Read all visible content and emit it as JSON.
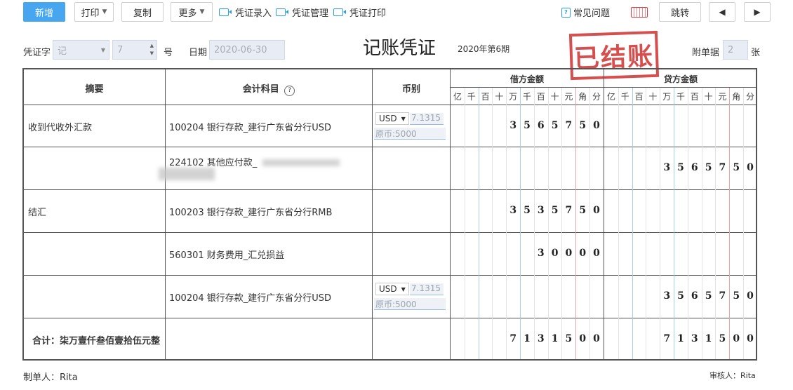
{
  "toolbar": {
    "new_label": "新增",
    "print_label": "打印",
    "copy_label": "复制",
    "more_label": "更多",
    "entry_link": "凭证录入",
    "manage_link": "凭证管理",
    "print_link": "凭证打印",
    "faq_label": "常见问题",
    "jump_label": "跳转"
  },
  "header": {
    "voucher_word_label": "凭证字",
    "voucher_word_value": "记",
    "voucher_number": "7",
    "number_suffix": "号",
    "date_label": "日期",
    "date_value": "2020-06-30",
    "title": "记账凭证",
    "period": "2020年第6期",
    "stamp_text": "已结账",
    "attachments_label": "附单据",
    "attachments_value": "2",
    "attachments_unit": "张"
  },
  "table": {
    "col_summary": "摘要",
    "col_account": "会计科目",
    "col_currency": "币别",
    "col_debit": "借方金额",
    "col_credit": "贷方金额",
    "units": [
      "亿",
      "千",
      "百",
      "十",
      "万",
      "千",
      "百",
      "十",
      "元",
      "角",
      "分"
    ],
    "rows": [
      {
        "summary": "收到代收外汇款",
        "account": "100204 银行存款_建行广东省分行USD",
        "currency": "USD",
        "rate": "7.1315",
        "original": "原币:5000",
        "debit": "3565750",
        "credit": ""
      },
      {
        "summary": "",
        "account": "224102 其他应付款_",
        "currency": "",
        "rate": "",
        "original": "",
        "debit": "",
        "credit": "3565750"
      },
      {
        "summary": "结汇",
        "account": "100203 银行存款_建行广东省分行RMB",
        "currency": "",
        "rate": "",
        "original": "",
        "debit": "3535750",
        "credit": ""
      },
      {
        "summary": "",
        "account": "560301 财务费用_汇兑损益",
        "currency": "",
        "rate": "",
        "original": "",
        "debit": "30000",
        "credit": ""
      },
      {
        "summary": "",
        "account": "100204 银行存款_建行广东省分行USD",
        "currency": "USD",
        "rate": "7.1315",
        "original": "原币:5000",
        "debit": "",
        "credit": "3565750"
      }
    ],
    "total_label": "合计：柒万壹仟叁佰壹拾伍元整",
    "total_debit": "7131500",
    "total_credit": "7131500"
  },
  "footer": {
    "maker": "制单人：Rita",
    "auditor": "审核人：Rita"
  }
}
